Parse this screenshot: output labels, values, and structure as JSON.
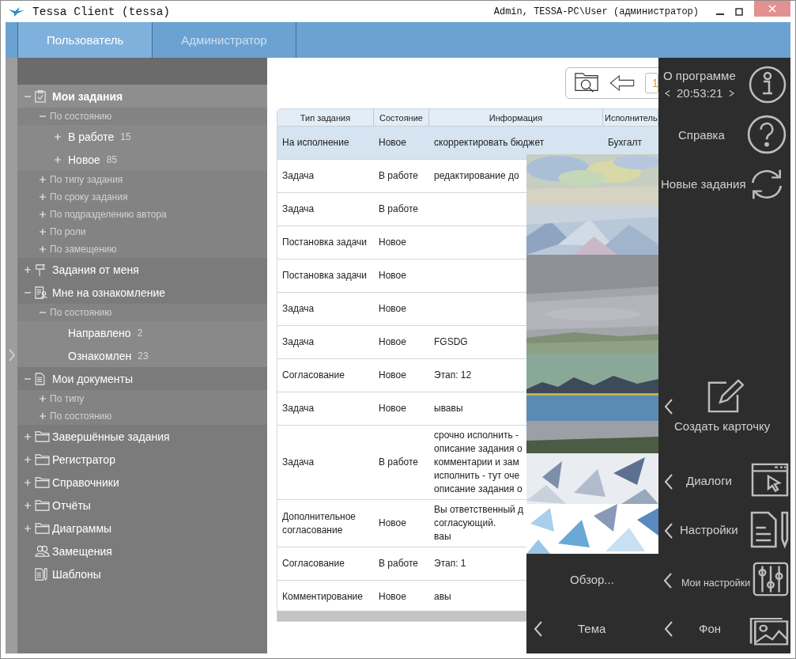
{
  "window": {
    "title": "Tessa Client (tessa)",
    "user": "Admin, TESSA-PC\\User (администратор)"
  },
  "tabs": [
    {
      "label": "Пользователь",
      "selected": true
    },
    {
      "label": "Администратор",
      "selected": false
    }
  ],
  "tree": [
    {
      "kind": "root",
      "label": "Мои задания",
      "toggle": true,
      "expanded": true,
      "selected": true,
      "children": [
        {
          "kind": "group",
          "label": "По состоянию",
          "toggle": true,
          "expanded": true,
          "selected": false,
          "children": [
            {
              "kind": "leaf",
              "label": "В работе",
              "count": "15",
              "toggle": true,
              "expanded": false,
              "selected": false
            },
            {
              "kind": "leaf",
              "label": "Новое",
              "count": "85",
              "toggle": true,
              "expanded": false,
              "selected": false
            }
          ]
        },
        {
          "kind": "group",
          "label": "По типу задания",
          "toggle": true,
          "expanded": false,
          "selected": false
        },
        {
          "kind": "group",
          "label": "По сроку задания",
          "toggle": true,
          "expanded": false,
          "selected": false
        },
        {
          "kind": "group",
          "label": "По подразделению автора",
          "toggle": true,
          "expanded": false,
          "selected": false
        },
        {
          "kind": "group",
          "label": "По роли",
          "toggle": true,
          "expanded": false,
          "selected": false
        },
        {
          "kind": "group",
          "label": "По замещению",
          "toggle": true,
          "expanded": false,
          "selected": false
        }
      ]
    },
    {
      "kind": "root",
      "label": "Задания от меня",
      "toggle": true,
      "expanded": false,
      "selected": false
    },
    {
      "kind": "root",
      "label": "Мне на ознакомление",
      "toggle": true,
      "expanded": true,
      "selected": false,
      "children": [
        {
          "kind": "group",
          "label": "По состоянию",
          "toggle": true,
          "expanded": true,
          "selected": false,
          "children": [
            {
              "kind": "leaf",
              "label": "Направлено",
              "count": "2",
              "toggle": false,
              "selected": false
            },
            {
              "kind": "leaf",
              "label": "Ознакомлен",
              "count": "23",
              "toggle": false,
              "selected": false
            }
          ]
        }
      ]
    },
    {
      "kind": "root",
      "label": "Мои документы",
      "toggle": true,
      "expanded": true,
      "selected": false,
      "children": [
        {
          "kind": "group",
          "label": "По типу",
          "toggle": true,
          "expanded": false,
          "selected": false
        },
        {
          "kind": "group",
          "label": "По состоянию",
          "toggle": true,
          "expanded": false,
          "selected": false
        }
      ]
    },
    {
      "kind": "root",
      "label": "Завершённые задания",
      "toggle": true,
      "expanded": false,
      "selected": false
    },
    {
      "kind": "root",
      "label": "Регистратор",
      "toggle": true,
      "expanded": false,
      "selected": false
    },
    {
      "kind": "root",
      "label": "Справочники",
      "toggle": true,
      "expanded": false,
      "selected": false
    },
    {
      "kind": "root",
      "label": "Отчёты",
      "toggle": true,
      "expanded": false,
      "selected": false
    },
    {
      "kind": "root",
      "label": "Диаграммы",
      "toggle": true,
      "expanded": false,
      "selected": false
    },
    {
      "kind": "root",
      "label": "Замещения",
      "toggle": false,
      "selected": false
    },
    {
      "kind": "root",
      "label": "Шаблоны",
      "toggle": false,
      "selected": false
    }
  ],
  "toolbar": {
    "page": "1"
  },
  "table": {
    "columns": [
      "Тип задания",
      "Состояние",
      "Информация",
      "Исполнитель"
    ],
    "rows": [
      {
        "type": "На исполнение",
        "state": "Новое",
        "info": [
          "скорректировать бюджет"
        ],
        "executor": "Бухгалт",
        "selected": true
      },
      {
        "type": "Задача",
        "state": "В работе",
        "info": [
          "редактирование до"
        ],
        "selected": false
      },
      {
        "type": "Задача",
        "state": "В работе",
        "selected": false
      },
      {
        "type": "Постановка задачи",
        "state": "Новое",
        "selected": false
      },
      {
        "type": "Постановка задачи",
        "state": "Новое",
        "selected": false
      },
      {
        "type": "Задача",
        "state": "Новое",
        "selected": false
      },
      {
        "type": "Задача",
        "state": "Новое",
        "info": [
          "FGSDG"
        ],
        "selected": false
      },
      {
        "type": "Согласование",
        "state": "Новое",
        "info": [
          "Этап: 12"
        ],
        "selected": false
      },
      {
        "type": "Задача",
        "state": "Новое",
        "info": [
          "ывавы"
        ],
        "selected": false
      },
      {
        "type": "Задача",
        "state": "В работе",
        "info": [
          "срочно исполнить -",
          "описание задания о",
          "комментарии и зам",
          "исполнить - тут оче",
          "описание задания о"
        ],
        "selected": false
      },
      {
        "type": "Дополнительное согласование",
        "state": "Новое",
        "info": [
          "Вы ответственный д",
          "согласующий.",
          "ваы"
        ],
        "selected": false
      },
      {
        "type": "Согласование",
        "state": "В работе",
        "info": [
          "Этап: 1"
        ],
        "selected": false
      },
      {
        "type": "Комментирование",
        "state": "Новое",
        "info": [
          "авы"
        ],
        "selected": false
      }
    ]
  },
  "menu": [
    {
      "kind": "top",
      "label": "О программе",
      "time": "20:53:21"
    },
    {
      "kind": "top",
      "label": "Справка"
    },
    {
      "kind": "top",
      "label": "Новые задания"
    },
    {
      "kind": "side",
      "label": "Создать карточку"
    },
    {
      "kind": "side",
      "label": "Диалоги"
    },
    {
      "kind": "side",
      "label": "Настройки"
    },
    {
      "kind": "plain",
      "label": "Обзор..."
    },
    {
      "kind": "side",
      "label": "Мои настройки"
    },
    {
      "kind": "side",
      "label": "Тема"
    },
    {
      "kind": "side",
      "label": "Фон"
    }
  ]
}
